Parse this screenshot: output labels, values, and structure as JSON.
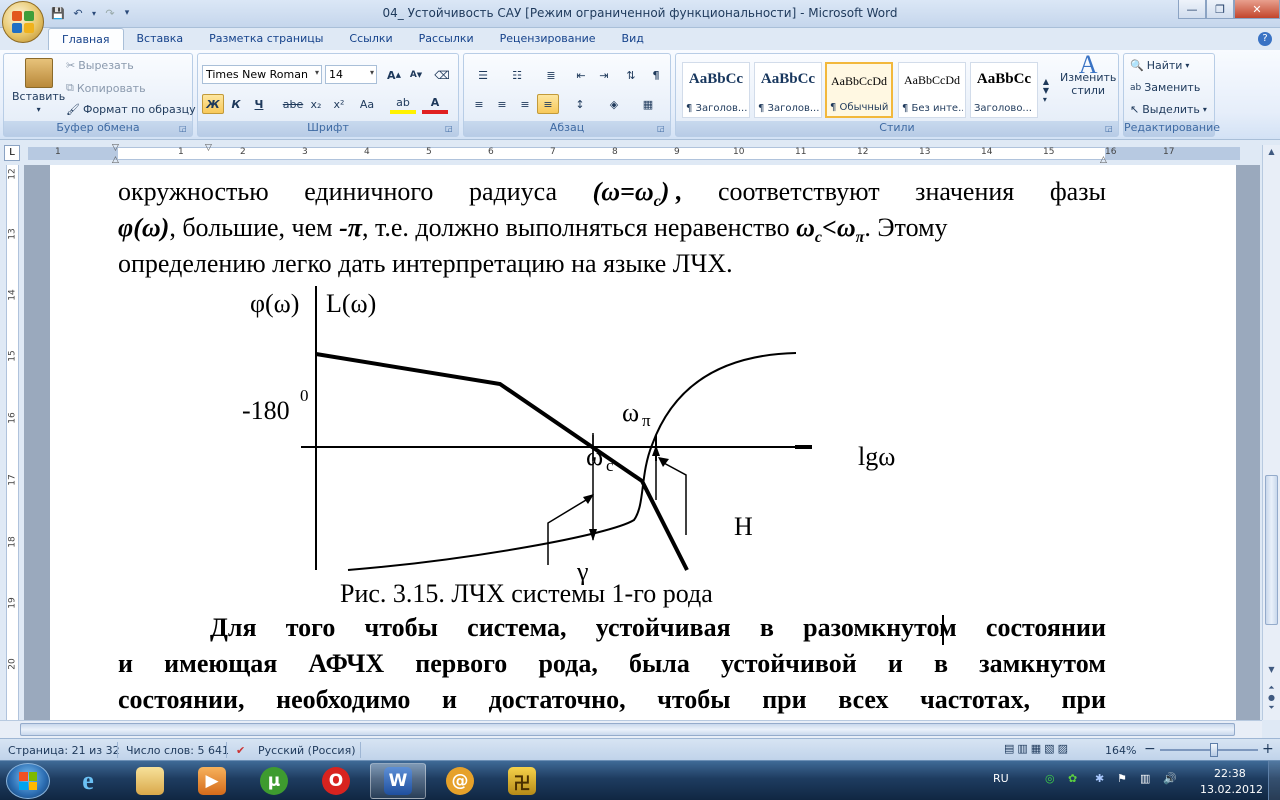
{
  "window": {
    "title": "04_ Устойчивость САУ [Режим ограниченной функциональности] - Microsoft Word"
  },
  "tabs": [
    "Главная",
    "Вставка",
    "Разметка страницы",
    "Ссылки",
    "Рассылки",
    "Рецензирование",
    "Вид"
  ],
  "ribbon": {
    "clipboard": {
      "label": "Буфер обмена",
      "paste": "Вставить",
      "cut": "Вырезать",
      "copy": "Копировать",
      "format_painter": "Формат по образцу"
    },
    "font": {
      "label": "Шрифт",
      "family": "Times New Roman",
      "size": "14",
      "grow": "A",
      "shrink": "A",
      "bold": "Ж",
      "italic": "К",
      "underline": "Ч",
      "strike": "abe",
      "subscript": "x₂",
      "superscript": "x²",
      "case": "Aa",
      "highlight": "ab",
      "color": "A"
    },
    "paragraph": {
      "label": "Абзац",
      "pilcrow": "¶"
    },
    "styles": {
      "label": "Стили",
      "items": [
        {
          "sample": "AaBbCc",
          "name": "¶ Заголов..."
        },
        {
          "sample": "AaBbCc",
          "name": "¶ Заголов..."
        },
        {
          "sample": "AaBbCcDd",
          "name": "¶ Обычный"
        },
        {
          "sample": "AaBbCcDd",
          "name": "¶ Без инте..."
        },
        {
          "sample": "AaBbCc",
          "name": "Заголово..."
        }
      ],
      "change": "Изменить",
      "change2": "стили"
    },
    "editing": {
      "label": "Редактирование",
      "find": "Найти",
      "replace": "Заменить",
      "select": "Выделить"
    }
  },
  "ruler": {
    "numbers": [
      "1",
      "1",
      "2",
      "3",
      "4",
      "5",
      "6",
      "7",
      "8",
      "9",
      "10",
      "11",
      "12",
      "13",
      "14",
      "15",
      "16",
      "17"
    ],
    "vnumbers": [
      "12",
      "13",
      "14",
      "15",
      "16",
      "17",
      "18",
      "19",
      "20"
    ]
  },
  "document": {
    "line1": [
      "окружностью",
      "единичного",
      "радиуса",
      "(ω=ω",
      "c",
      ")",
      ",",
      "соответствуют",
      "значения",
      "фазы"
    ],
    "line2_a": "φ(ω)",
    "line2_b": ", большие, чем ",
    "line2_c": "-π",
    "line2_d": ", т.е. должно выполняться неравенство ",
    "line2_e": "ω",
    "line2_e_sub": "c",
    "line2_f": "<ω",
    "line2_f_sub": "π",
    "line2_g": ". Этому",
    "line3": "определению легко дать интерпретацию на языке ЛЧХ.",
    "caption": "Рис. 3.15. ЛЧХ системы 1-го рода",
    "para_indent_words": [
      "Для",
      "того",
      "чтобы",
      "система,",
      "устойчивая",
      "в",
      "разомкнутом",
      "состоянии"
    ],
    "para_line2": [
      "и",
      "имеющая",
      "АФЧХ",
      "первого",
      "рода,",
      "была",
      "устойчивой",
      "и",
      "в",
      "замкнутом"
    ],
    "para_line3": [
      "состоянии,",
      "необходимо",
      "и",
      "достаточно,",
      "чтобы",
      "при",
      "всех",
      "частотах,",
      "при"
    ]
  },
  "figure": {
    "phi_label": "φ(ω)",
    "L_label": "L(ω)",
    "minus180": "-180",
    "deg": "0",
    "omega_pi": "ω",
    "pi_sub": "π",
    "omega_c": "ω",
    "c_sub": "c",
    "lg": "lgω",
    "H": "H",
    "gamma": "γ"
  },
  "status": {
    "page": "Страница: 21 из 32",
    "words": "Число слов: 5 641",
    "language": "Русский (Россия)",
    "zoom": "164%",
    "minus": "−",
    "plus": "+"
  },
  "taskbar": {
    "lang": "RU",
    "time": "22:38",
    "date": "13.02.2012"
  }
}
